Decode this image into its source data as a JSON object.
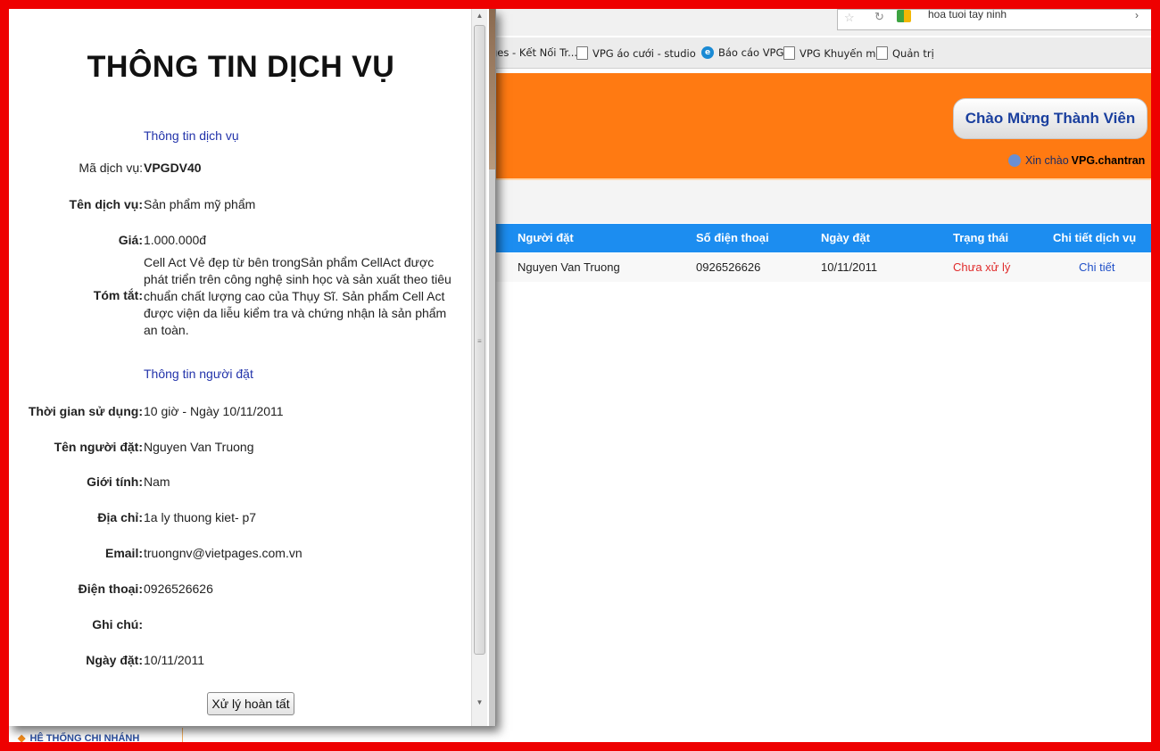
{
  "browser": {
    "address_text": "hoa tuoi tay ninh",
    "bookmarks": [
      {
        "label": "ges - Kết Nối Tr...",
        "icon": "none"
      },
      {
        "label": "VPG áo cưới - studio",
        "icon": "page-icon"
      },
      {
        "label": "Báo cáo VPG",
        "icon": "ie-icon"
      },
      {
        "label": "VPG Khuyến mãi",
        "icon": "page-icon"
      },
      {
        "label": "Quản trị",
        "icon": "page-icon"
      }
    ]
  },
  "header": {
    "welcome_button": "Chào Mừng Thành Viên",
    "greeting": "Xin chào",
    "username": "VPG.chantran"
  },
  "orders_table": {
    "columns": [
      "Người đặt",
      "Số điện thoại",
      "Ngày đặt",
      "Trạng thái",
      "Chi tiết dịch vụ"
    ],
    "rows": [
      {
        "customer": "Nguyen Van Truong",
        "phone": "0926526626",
        "date": "10/11/2011",
        "status": "Chưa xử lý",
        "detail": "Chi tiết"
      }
    ]
  },
  "sidebar": {
    "branch_label": "HỆ THỐNG CHI NHÁNH"
  },
  "popup": {
    "title": "THÔNG TIN DỊCH VỤ",
    "service_section": "Thông tin dịch vụ",
    "service": {
      "code_label": "Mã dịch vụ:",
      "code": "VPGDV40",
      "name_label": "Tên dịch vụ:",
      "name": "Sản phẩm mỹ phẩm",
      "price_label": "Giá:",
      "price": "1.000.000đ",
      "summary_label": "Tóm tắt:",
      "summary": "Cell Act Vẻ đẹp từ bên trongSản phẩm CellAct được phát triển trên công nghệ sinh học và sản xuất theo tiêu chuẩn chất lượng cao của Thụy Sĩ. Sản phẩm Cell Act được viện da liễu kiểm tra và chứng nhận là sản phẩm an toàn."
    },
    "customer_section": "Thông tin người đặt",
    "customer": {
      "time_label": "Thời gian sử dụng:",
      "time": "10 giờ - Ngày 10/11/2011",
      "name_label": "Tên người đặt:",
      "name": "Nguyen Van Truong",
      "gender_label": "Giới tính:",
      "gender": "Nam",
      "address_label": "Địa chỉ:",
      "address": "1a ly thuong kiet- p7",
      "email_label": "Email:",
      "email": "truongnv@vietpages.com.vn",
      "phone_label": "Điện thoại:",
      "phone": "0926526626",
      "note_label": "Ghi chú:",
      "note": "",
      "date_label": "Ngày đặt:",
      "date": "10/11/2011"
    },
    "done_button": "Xử lý hoàn tất"
  },
  "colors": {
    "frame": "#ee0000",
    "header_orange": "#ff7a12",
    "table_header_blue": "#1c8df0",
    "status_red": "#e02b2b",
    "link_blue": "#2050c8",
    "section_title_blue": "#2233aa"
  }
}
